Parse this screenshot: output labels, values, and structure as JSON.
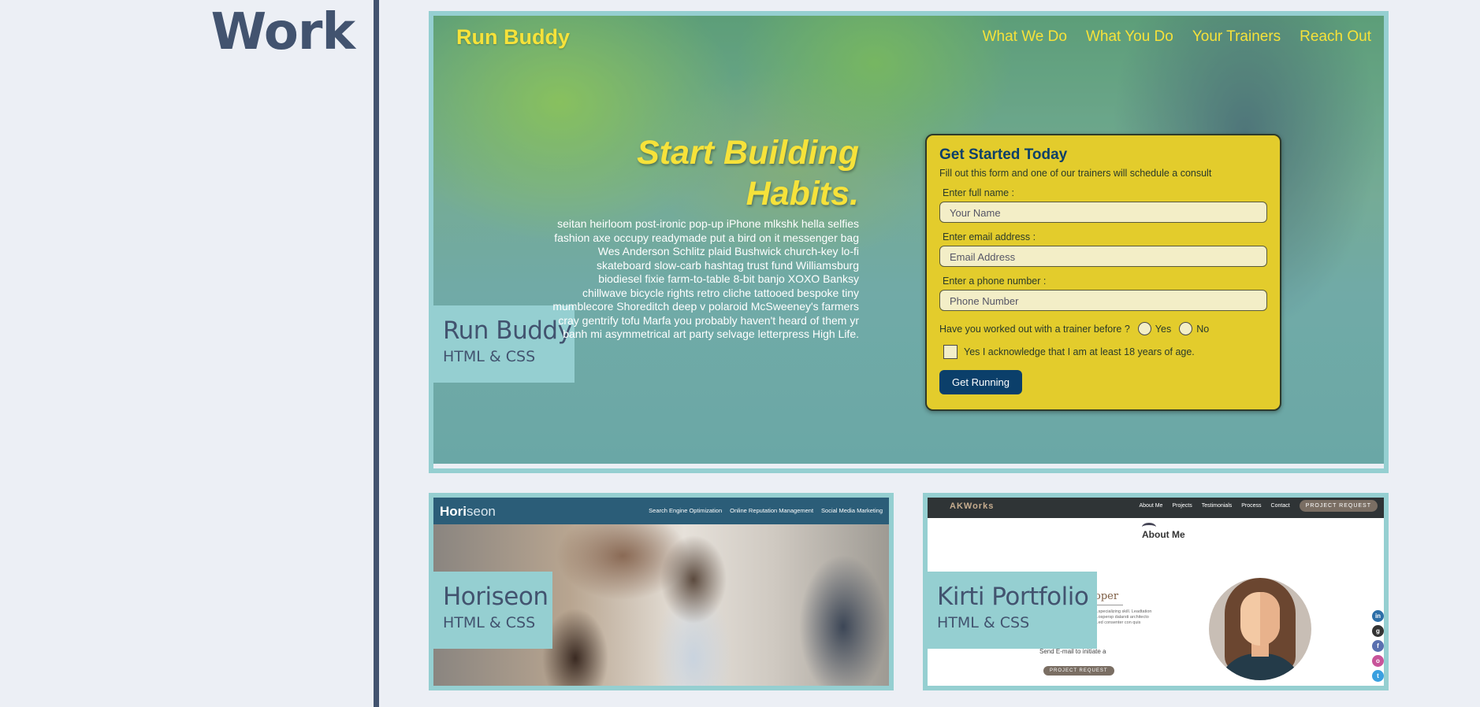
{
  "section": {
    "title": "Work"
  },
  "projects": [
    {
      "name": "Run Buddy",
      "tech": "HTML & CSS",
      "screenshot": {
        "logo": "Run Buddy",
        "nav": [
          "What We Do",
          "What You Do",
          "Your Trainers",
          "Reach Out"
        ],
        "hero_title": "Start Building Habits.",
        "hero_text": "seitan heirloom post-ironic pop-up iPhone mlkshk hella selfies fashion axe occupy readymade put a bird on it messenger bag Wes Anderson Schlitz plaid Bushwick church-key lo-fi skateboard slow-carb hashtag trust fund Williamsburg biodiesel fixie farm-to-table 8-bit banjo XOXO Banksy chillwave bicycle rights retro cliche tattooed bespoke tiny mumblecore Shoreditch deep v polaroid McSweeney's farmers cray gentrify tofu Marfa you probably haven't heard of them yr banh mi asymmetrical art party selvage letterpress High Life.",
        "form": {
          "title": "Get Started Today",
          "subtitle": "Fill out this form and one of our trainers will schedule a consult",
          "name_label": "Enter full name :",
          "name_placeholder": "Your Name",
          "email_label": "Enter email address :",
          "email_placeholder": "Email Address",
          "phone_label": "Enter a phone number :",
          "phone_placeholder": "Phone Number",
          "question": "Have you worked out with a trainer before ?",
          "yes": "Yes",
          "no": "No",
          "acknowledge": "Yes I acknowledge that I am at least 18 years of age.",
          "submit": "Get Running"
        }
      }
    },
    {
      "name": "Horiseon",
      "tech": "HTML & CSS",
      "screenshot": {
        "logo_bold": "Hori",
        "logo_rest": "seon",
        "nav": [
          "Search Engine Optimization",
          "Online Reputation Management",
          "Social Media Marketing"
        ]
      }
    },
    {
      "name": "Kirti Portfolio",
      "tech": "HTML & CSS",
      "screenshot": {
        "logo": "AKWorks",
        "nav": [
          "About Me",
          "Projects",
          "Testimonials",
          "Process",
          "Contact"
        ],
        "request_button": "PROJECT REQUEST",
        "about_heading": "About Me",
        "dev_heading": "oper",
        "small_text": "...specializing skill. Leadtation ...ospersp dalarsti architecto ...ed consenter con quis",
        "send_text": "Send E-mail to initiate a",
        "request_small": "PROJECT REQUEST",
        "social": [
          "in",
          "g",
          "f",
          "o",
          "t"
        ]
      }
    }
  ]
}
